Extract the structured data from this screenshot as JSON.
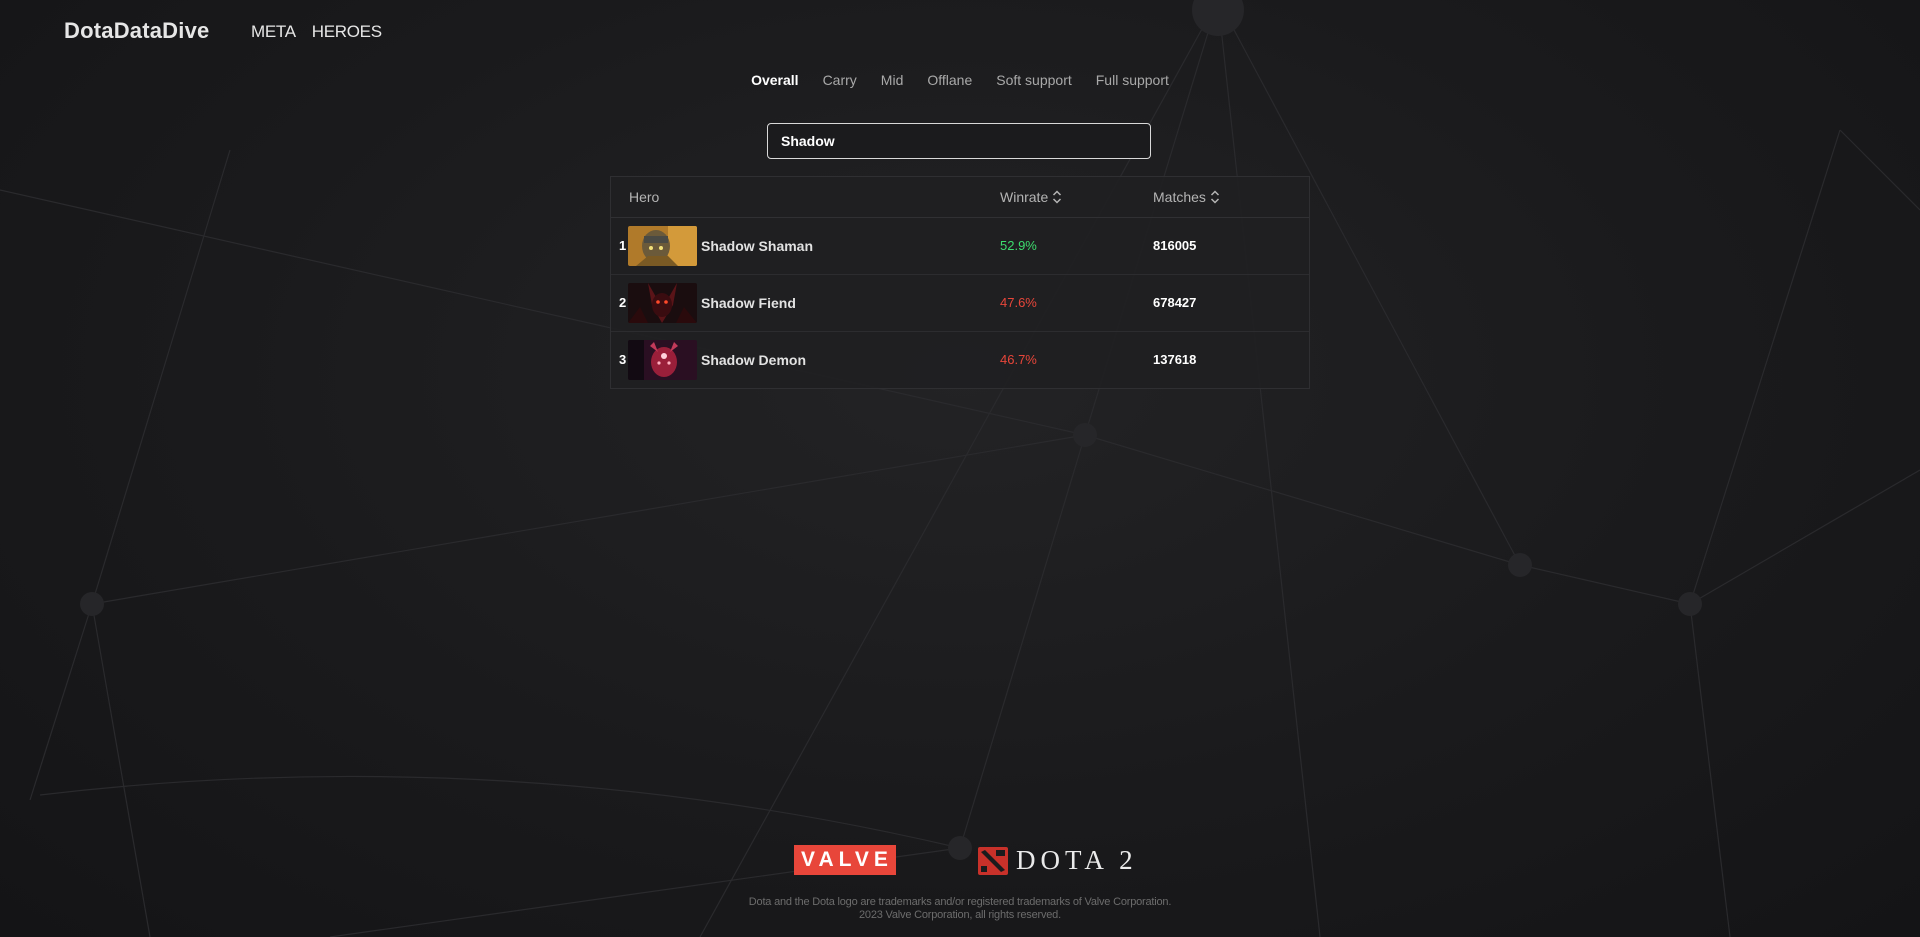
{
  "header": {
    "brand": "DotaDataDive",
    "nav": [
      "META",
      "HEROES"
    ]
  },
  "tabs": [
    {
      "label": "Overall",
      "active": true
    },
    {
      "label": "Carry",
      "active": false
    },
    {
      "label": "Mid",
      "active": false
    },
    {
      "label": "Offlane",
      "active": false
    },
    {
      "label": "Soft support",
      "active": false
    },
    {
      "label": "Full support",
      "active": false
    }
  ],
  "search": {
    "value": "Shadow"
  },
  "table": {
    "columns": {
      "hero": "Hero",
      "winrate": "Winrate",
      "matches": "Matches"
    },
    "rows": [
      {
        "rank": "1",
        "hero": "Shadow Shaman",
        "winrate": "52.9%",
        "matches": "816005",
        "winrate_color": "#3ddc6e",
        "portrait": "shadow-shaman-portrait"
      },
      {
        "rank": "2",
        "hero": "Shadow Fiend",
        "winrate": "47.6%",
        "matches": "678427",
        "winrate_color": "#e8463a",
        "portrait": "shadow-fiend-portrait"
      },
      {
        "rank": "3",
        "hero": "Shadow Demon",
        "winrate": "46.7%",
        "matches": "137618",
        "winrate_color": "#e8463a",
        "portrait": "shadow-demon-portrait"
      }
    ]
  },
  "footer": {
    "valve_logo": "VALVE",
    "dota_logo": "DOTA 2",
    "legal": "Dota and the Dota logo are trademarks and/or registered trademarks of Valve Corporation. 2023 Valve Corporation, all rights reserved."
  },
  "colors": {
    "positive": "#3ddc6e",
    "negative": "#e8463a",
    "valve_red": "#e8463a"
  }
}
